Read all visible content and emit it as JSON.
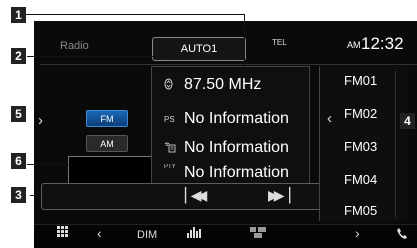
{
  "header": {
    "source_title": "Radio",
    "status_pill": "AUTO1",
    "tel_label": "TEL",
    "ampm": "AM",
    "clock": "12:32"
  },
  "band": {
    "fm_label": "FM",
    "am_label": "AM",
    "selected": "FM"
  },
  "info": {
    "frequency": "87.50 MHz",
    "ps_icon": "PS",
    "ps_text": "No Information",
    "radiotext_icon": "radio-text-icon",
    "radiotext_text": "No Information",
    "pty_icon": "PTY",
    "pty_text": "No Information"
  },
  "presets": [
    "FM01",
    "FM02",
    "FM03",
    "FM04",
    "FM05"
  ],
  "bottom_bar": {
    "dim_label": "DIM"
  },
  "callouts": [
    "1",
    "2",
    "3",
    "4",
    "5",
    "6"
  ]
}
